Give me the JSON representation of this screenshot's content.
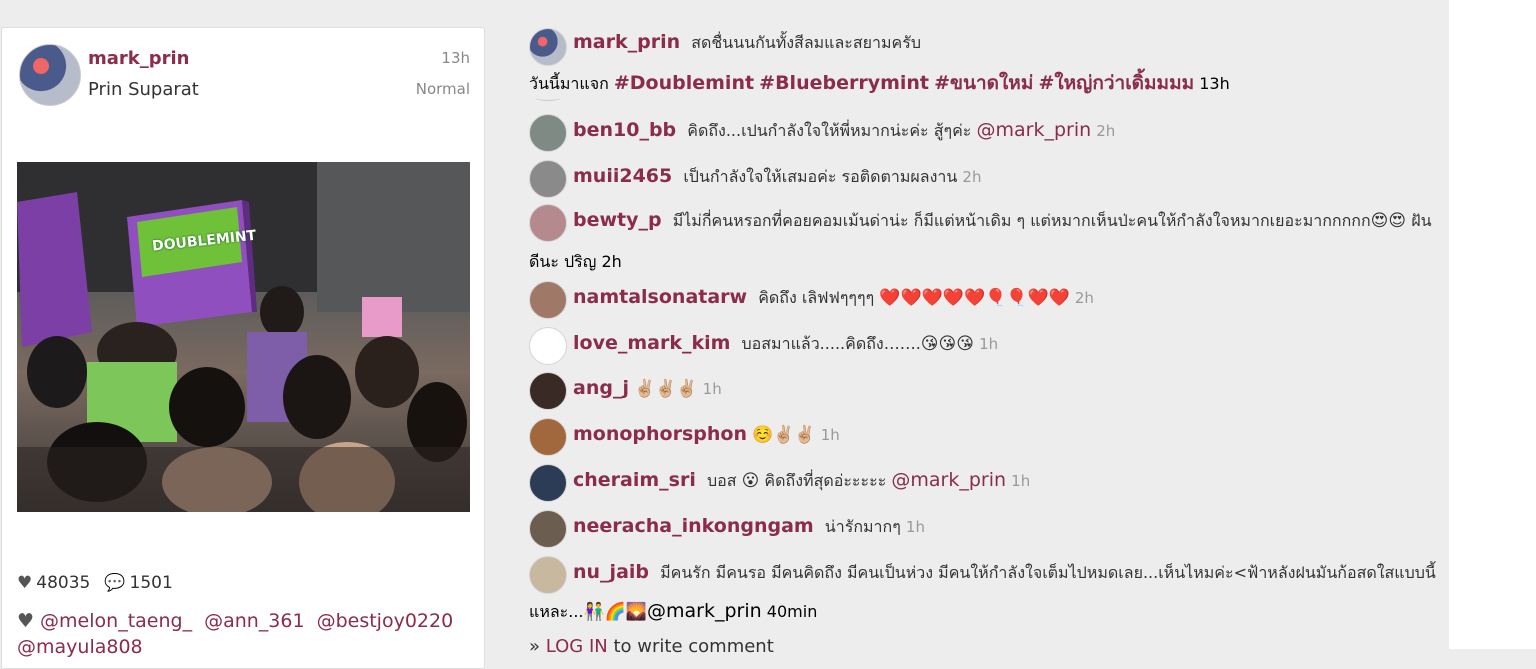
{
  "post": {
    "username": "mark_prin",
    "full_name": "Prin Suparat",
    "time": "13h",
    "filter": "Normal",
    "photo_sign_text": "DOUBLEMINT",
    "likes": "48035",
    "comments_count": "1501",
    "tags": [
      "@melon_taeng_",
      "@ann_361",
      "@bestjoy0220",
      "@mayula808"
    ]
  },
  "caption": {
    "username": "mark_prin",
    "text": "สดชื่นนนกันทั้งสีลมและสยามครับ",
    "line2_prefix": "วันนี้มาแจก",
    "hashtags": [
      "#Doublemint",
      "#Blueberrymint",
      "#ขนาดใหม่",
      "#ใหญ่กว่าเดิ้มมมม"
    ],
    "time": "13h"
  },
  "comments": [
    {
      "user": "ben10_bb",
      "text": "คิดถึง...เปนกำลังใจให้พี่หมากน่ะค่ะ สู้ๆค่ะ",
      "mention": "@mark_prin",
      "time": "2h",
      "avatar": "#7f8a84"
    },
    {
      "user": "muii2465",
      "text": "เป็นกำลังใจให้เสมอค่ะ รอติดตามผลงาน",
      "time": "2h",
      "avatar": "#8a8a8a"
    },
    {
      "user": "bewty_p",
      "text": "มีไม่กี่คนหรอกที่คอยคอมเม้นด่าน่ะ ก็มีแต่หน้าเดิม ๆ แต่หมากเห็นป่ะคนให้กำลังใจหมากเยอะมากกกกก",
      "emoji": "😍😍",
      "text_after": "ฝัน",
      "line2": "ดีนะ ปริญ",
      "time": "2h",
      "avatar": "#b48a8e"
    },
    {
      "user": "namtalsonatarw",
      "text": "คิดถึง เลิฟฟๆๆๆๆ",
      "emoji": "❤️❤️❤️❤️❤️🎈🎈❤️❤️",
      "time": "2h",
      "avatar": "#a07868"
    },
    {
      "user": "love_mark_kim",
      "text": "บอสมาแล้ว.....คิดถึง…….",
      "emoji": "😘😘😘",
      "time": "1h",
      "avatar": "#ffffff"
    },
    {
      "user": "ang_j",
      "text": "",
      "emoji": "✌🏼✌🏼✌🏼",
      "time": "1h",
      "avatar": "#3a2a25"
    },
    {
      "user": "monophorsphon",
      "text": "",
      "emoji": "☺️✌🏼✌🏼",
      "time": "1h",
      "avatar": "#a0683c"
    },
    {
      "user": "cheraim_sri",
      "text": "บอส",
      "emoji": "😮",
      "text_after": "คิดถึงที่สุดอ่ะะะะะ",
      "mention": "@mark_prin",
      "time": "1h",
      "avatar": "#2c3b56"
    },
    {
      "user": "neeracha_inkongngam",
      "text": "น่ารักมากๆ",
      "time": "1h",
      "avatar": "#6b5e50"
    },
    {
      "user": "nu_jaib",
      "text": "มีคนรัก มีคนรอ มีคนคิดถึง มีคนเป็นห่วง มีคนให้กำลังใจเต็มไปหมดเลย...เห็นไหมค่ะ<ฟ้าหลังฝนมันก้อสดใสแบบนี้",
      "line2": "แหละ...",
      "emoji2": "👫🌈🌄",
      "mention2": "@mark_prin",
      "time": "40min",
      "avatar": "#c8b8a0"
    }
  ],
  "login": {
    "prefix": "»",
    "link": "LOG IN",
    "suffix": "to write comment"
  }
}
